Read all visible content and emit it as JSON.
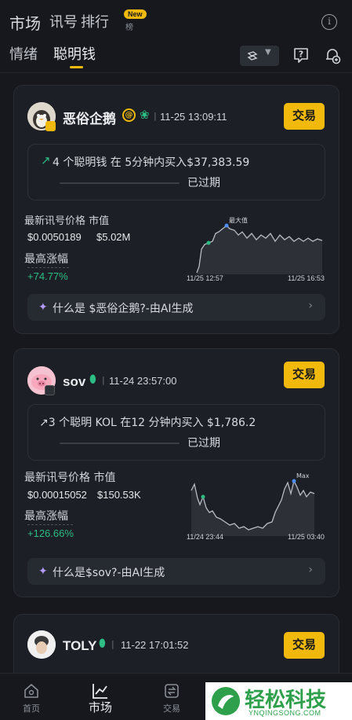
{
  "top_tabs": {
    "market": "市场",
    "signal": "讯号",
    "rank": "排行",
    "new_badge": "New",
    "new_sub": "榜"
  },
  "sub_tabs": {
    "emotion": "情绪",
    "smart_money": "聪明钱"
  },
  "cards": [
    {
      "name": "恶俗企鹅",
      "time": "11-25 13:09:11",
      "trade": "交易",
      "signal_text": "4 个聪明钱 在 5分钟内买入$37,383.59",
      "status": "已过期",
      "price_label": "最新讯号价格 市值",
      "price": "$0.0050189",
      "mcap": "$5.02M",
      "max_gain_label": "最高涨幅",
      "max_gain": "+74.77%",
      "chart_start": "11/25 12:57",
      "chart_end": "11/25 16:53",
      "chart_max_label": "最大值",
      "ai_text": "什么是 $恶俗企鹅?-由AI生成"
    },
    {
      "name": "sov",
      "time": "11-24 23:57:00",
      "trade": "交易",
      "signal_text": "↗3 个聪明 KOL 在12 分钟内买入 $1,786.2",
      "status": "已过期",
      "price_label": "最新讯号价格 市值",
      "price": "$0.00015052",
      "mcap": "$150.53K",
      "max_gain_label": "最高涨幅",
      "max_gain": "+126.66%",
      "chart_start": "11/24 23:44",
      "chart_end": "11/25 03:40",
      "chart_max_label": "Max",
      "ai_text": "什么是$sov?-由AI生成"
    },
    {
      "name": "TOLY",
      "time": "11-22 17:01:52",
      "trade": "交易"
    }
  ],
  "bottom_nav": [
    {
      "label": "首页",
      "icon": "home-icon"
    },
    {
      "label": "市场",
      "icon": "market-chart-icon"
    },
    {
      "label": "交易",
      "icon": "trade-icon"
    },
    {
      "label": "",
      "icon": "search-icon"
    },
    {
      "label": "",
      "icon": "wallet-icon"
    }
  ],
  "watermark": {
    "text": "轻松科技",
    "sub": "YNQINGSONG.COM"
  },
  "colors": {
    "accent": "#f0b90b",
    "up": "#2ebd85",
    "bg": "#16181d",
    "card": "#1c1f25"
  }
}
